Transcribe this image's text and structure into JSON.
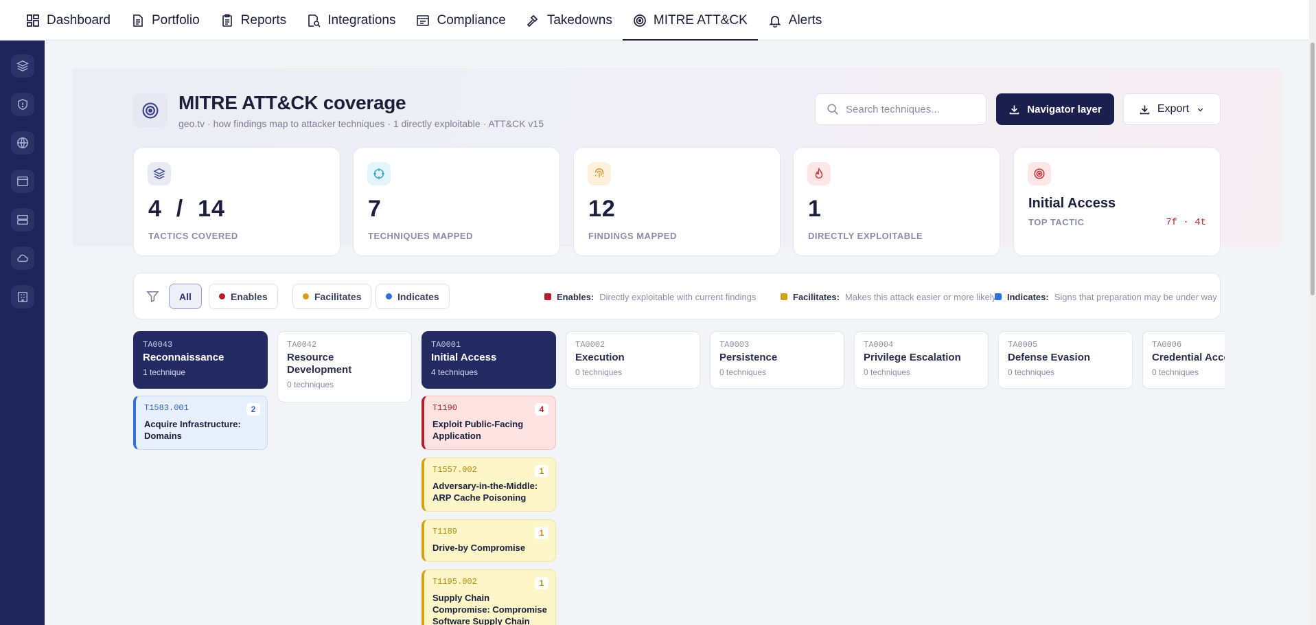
{
  "nav": {
    "items": [
      {
        "label": "Dashboard"
      },
      {
        "label": "Portfolio"
      },
      {
        "label": "Reports"
      },
      {
        "label": "Integrations"
      },
      {
        "label": "Compliance"
      },
      {
        "label": "Takedowns"
      },
      {
        "label": "MITRE ATT&CK"
      },
      {
        "label": "Alerts"
      }
    ],
    "active": "MITRE ATT&CK"
  },
  "header": {
    "title": "MITRE ATT&CK coverage",
    "subtitle": "geo.tv · how findings map to attacker techniques · 1 directly exploitable · ATT&CK v15",
    "search_placeholder": "Search techniques...",
    "navigator_label": "Navigator layer",
    "export_label": "Export"
  },
  "stats": [
    {
      "value": "4  /  14",
      "label": "TACTICS COVERED"
    },
    {
      "value": "7",
      "label": "TECHNIQUES MAPPED"
    },
    {
      "value": "12",
      "label": "FINDINGS MAPPED"
    },
    {
      "value": "1",
      "label": "DIRECTLY EXPLOITABLE"
    }
  ],
  "top_tactic": {
    "title": "Initial Access",
    "label": "TOP TACTIC",
    "meta": "7f · 4t"
  },
  "filters": {
    "all": "All",
    "enables": "Enables",
    "facilitates": "Facilitates",
    "indicates": "Indicates"
  },
  "legend": {
    "enables": {
      "term": "Enables:",
      "desc": "Directly exploitable with current findings"
    },
    "facilitates": {
      "term": "Facilitates:",
      "desc": "Makes this attack easier or more likely"
    },
    "indicates": {
      "term": "Indicates:",
      "desc": "Signs that preparation may be under way"
    }
  },
  "colors": {
    "enables": "#b3202a",
    "facilitates": "#d4a11a",
    "indicates": "#2f6fe0",
    "primary": "#1b1f4d"
  },
  "tactics": [
    {
      "id": "TA0043",
      "name": "Reconnaissance",
      "count": "1 technique"
    },
    {
      "id": "TA0042",
      "name": "Resource Development",
      "count": "0 techniques"
    },
    {
      "id": "TA0001",
      "name": "Initial Access",
      "count": "4 techniques"
    },
    {
      "id": "TA0002",
      "name": "Execution",
      "count": "0 techniques"
    },
    {
      "id": "TA0003",
      "name": "Persistence",
      "count": "0 techniques"
    },
    {
      "id": "TA0004",
      "name": "Privilege Escalation",
      "count": "0 techniques"
    },
    {
      "id": "TA0005",
      "name": "Defense Evasion",
      "count": "0 techniques"
    },
    {
      "id": "TA0006",
      "name": "Credential Access",
      "count": "0 techniques"
    }
  ],
  "techniques": {
    "recon": [
      {
        "code": "T1583.001",
        "name": "Acquire Infrastructure: Domains",
        "count": "2"
      }
    ],
    "initial_access": [
      {
        "code": "T1190",
        "name": "Exploit Public-Facing Application",
        "count": "4"
      },
      {
        "code": "T1557.002",
        "name": "Adversary-in-the-Middle: ARP Cache Poisoning",
        "count": "1"
      },
      {
        "code": "T1189",
        "name": "Drive-by Compromise",
        "count": "1"
      },
      {
        "code": "T1195.002",
        "name": "Supply Chain Compromise: Compromise Software Supply Chain",
        "count": "1"
      }
    ]
  }
}
